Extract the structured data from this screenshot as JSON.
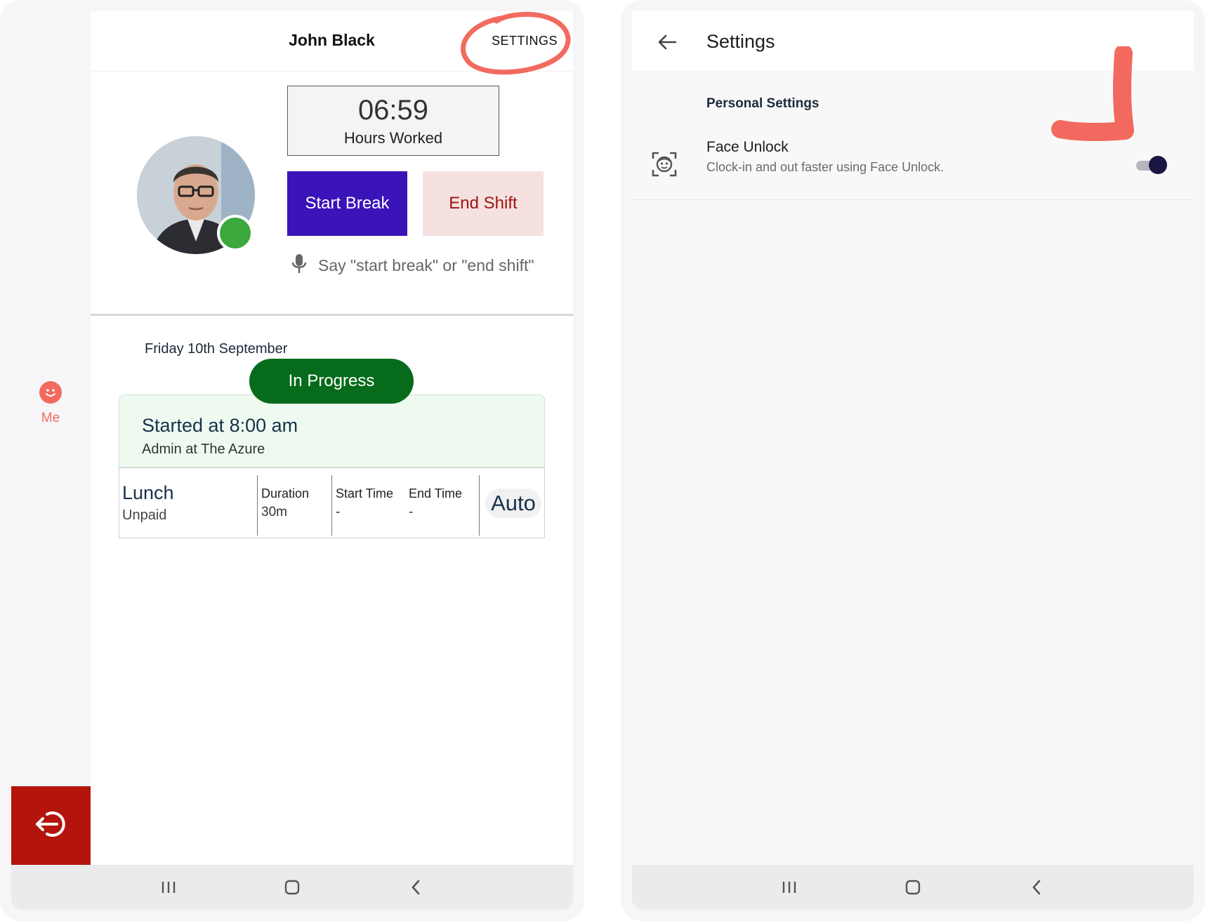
{
  "left": {
    "header": {
      "user_name": "John Black",
      "settings_label": "SETTINGS"
    },
    "hours": {
      "time": "06:59",
      "label": "Hours Worked"
    },
    "buttons": {
      "start_break": "Start Break",
      "end_shift": "End Shift"
    },
    "voice_hint": "Say \"start break\" or \"end shift\"",
    "date": "Friday 10th September",
    "shift": {
      "status": "In Progress",
      "started": "Started at 8:00 am",
      "role": "Admin at The Azure"
    },
    "break": {
      "name": "Lunch",
      "type": "Unpaid",
      "duration_label": "Duration",
      "duration_value": "30m",
      "start_label": "Start Time",
      "start_value": "-",
      "end_label": "End Time",
      "end_value": "-",
      "auto_label": "Auto"
    },
    "rail": {
      "me_label": "Me"
    }
  },
  "right": {
    "header": {
      "title": "Settings"
    },
    "section_title": "Personal Settings",
    "face_unlock": {
      "title": "Face Unlock",
      "description": "Clock-in and out faster using Face Unlock.",
      "enabled": true
    }
  },
  "colors": {
    "accent_purple": "#3a14b8",
    "end_shift_text": "#a01410",
    "in_progress": "#066b1a",
    "logout_red": "#b3150c",
    "me_coral": "#f26a5f",
    "annotation_coral": "#f26a5f"
  },
  "icons": {
    "rail_me": "smiley-icon",
    "logout": "logout-icon",
    "voice": "microphone-icon",
    "back": "arrow-left-icon",
    "face_unlock": "face-scan-icon",
    "nav_recents": "recents-icon",
    "nav_home": "home-icon",
    "nav_back": "back-chevron-icon"
  }
}
